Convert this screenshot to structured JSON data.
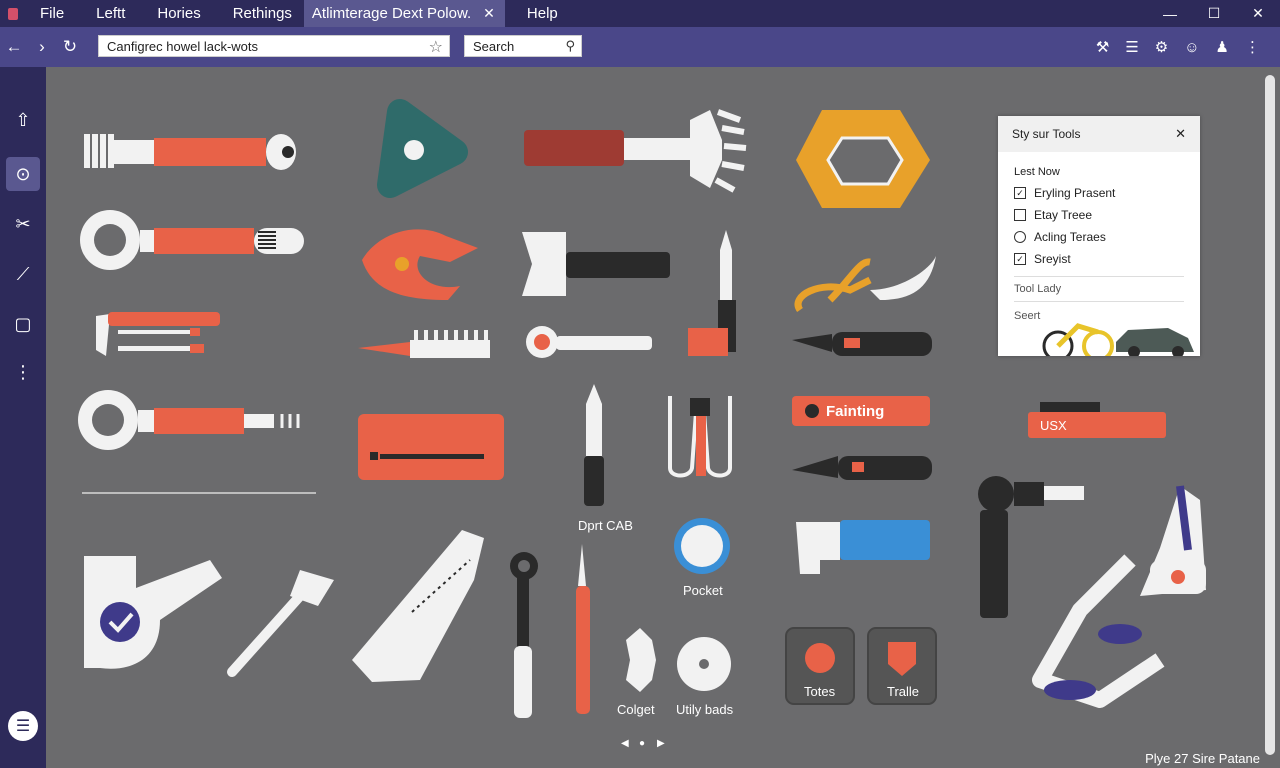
{
  "menubar": {
    "items": [
      "File",
      "Leftt",
      "Hories",
      "Rethings"
    ],
    "active_tab": "Atlimterage Dext Polow.",
    "active_tab_close": "✕",
    "help": "Help",
    "window_controls": [
      "—",
      "☐",
      "✕"
    ]
  },
  "toolbar": {
    "back": "←",
    "forward": "›",
    "reload": "↻",
    "address": "Canfigrec howel lack-wots",
    "star": "☆",
    "search_label": "Search",
    "search_icon": "⚲",
    "right_icons": [
      "⚒",
      "☰",
      "⚙",
      "☺",
      "♟",
      "⋮"
    ]
  },
  "sidebar": {
    "icons": [
      "⇧",
      "⊙",
      "✂",
      "⟋",
      "▢",
      "⋮"
    ],
    "bottom_icon": "☰"
  },
  "labels": {
    "fainting": "Fainting",
    "usx": "USX",
    "dprt_cab": "Dprt CAB",
    "pocket": "Pocket",
    "colget": "Colget",
    "utily_bads": "Utily bads",
    "totes": "Totes",
    "tralle": "Tralle",
    "pager_prev": "◀",
    "pager_dot": "●",
    "pager_next": "▶"
  },
  "panel": {
    "title": "Sty sur Tools",
    "close": "✕",
    "section1": "Lest Now",
    "options": [
      {
        "label": "Eryling Prasent",
        "type": "checkbox",
        "checked": true
      },
      {
        "label": "Etay Treee",
        "type": "checkbox",
        "checked": false
      },
      {
        "label": "Acling Teraes",
        "type": "radio",
        "checked": false
      },
      {
        "label": "Sreyist",
        "type": "checkbox",
        "checked": true
      }
    ],
    "section2": "Tool Lady",
    "section3": "Seert"
  },
  "footer": "Plye 27 Sire Patane",
  "colors": {
    "accent_orange": "#e86248",
    "dark_purple": "#2d2a5a",
    "mid_purple": "#4a4789",
    "canvas_gray": "#6b6b6d",
    "tool_white": "#f2f2f2",
    "tool_black": "#2a2a2a",
    "tool_yellow": "#e8a12a",
    "tool_teal": "#2f6b6a",
    "tool_blue": "#3a8fd6"
  }
}
